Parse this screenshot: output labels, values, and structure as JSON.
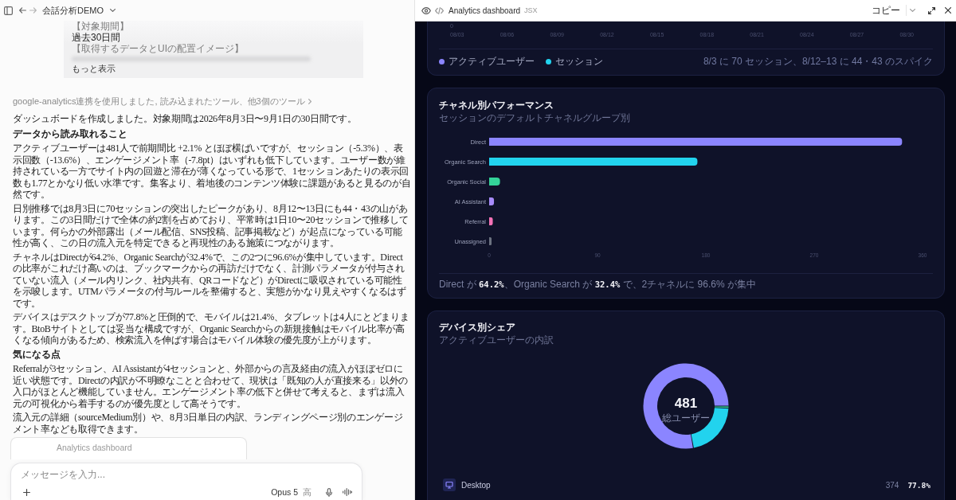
{
  "chat": {
    "title": "会話分析DEMO",
    "quoted_message": {
      "lines": [
        {
          "kind": "label",
          "text": "【対象期間】"
        },
        {
          "kind": "value",
          "text": "過去30日間"
        },
        {
          "kind": "label",
          "text": "【取得するデータとUIの配置イメージ】"
        },
        {
          "kind": "blurred"
        }
      ],
      "more_link": "もっと表示"
    },
    "tool_usage": "google-analytics連携を使用しました, 読み込まれたツール、他3個のツール",
    "response": [
      {
        "kind": "paragraph",
        "text": "ダッシュボードを作成しました。対象期間は2026年8月3日〜9月1日の30日間です。"
      },
      {
        "kind": "heading",
        "text": "データから読み取れること"
      },
      {
        "kind": "paragraph",
        "text": "アクティブユーザーは481人で前期間比 +2.1% とほぼ横ばいですが、セッション（-5.3%）、表示回数（-13.6%）、エンゲージメント率（-7.8pt）はいずれも低下しています。ユーザー数が維持されている一方でサイト内の回遊と滞在が薄くなっている形で、1セッションあたりの表示回数も1.77とかなり低い水準です。集客より、着地後のコンテンツ体験に課題があると見るのが自然です。"
      },
      {
        "kind": "paragraph",
        "text": "日別推移では8月3日に70セッションの突出したピークがあり、8月12〜13日にも44・43の山があります。この3日間だけで全体の約2割を占めており、平常時は1日10〜20セッションで推移しています。何らかの外部露出（メール配信、SNS投稿、記事掲載など）が起点になっている可能性が高く、この日の流入元を特定できると再現性のある施策につながります。"
      },
      {
        "kind": "paragraph",
        "text": "チャネルはDirectが64.2%、Organic Searchが32.4%で、この2つに96.6%が集中しています。Directの比率がこれだけ高いのは、ブックマークからの再訪だけでなく、計測パラメータが付与されていない流入（メール内リンク、社内共有、QRコードなど）がDirectに吸収されている可能性を示唆します。UTMパラメータの付与ルールを整備すると、実態がかなり見えやすくなるはずです。"
      },
      {
        "kind": "paragraph",
        "text": "デバイスはデスクトップが77.8%と圧倒的で、モバイルは21.4%、タブレットは4人にとどまります。BtoBサイトとしては妥当な構成ですが、Organic Searchからの新規接触はモバイル比率が高くなる傾向があるため、検索流入を伸ばす場合はモバイル体験の優先度が上がります。"
      },
      {
        "kind": "heading",
        "text": "気になる点"
      },
      {
        "kind": "paragraph",
        "text": "Referralが3セッション、AI Assistantが4セッションと、外部からの言及経由の流入がほぼゼロに近い状態です。Directの内訳が不明瞭なことと合わせて、現状は「既知の人が直接来る」以外の入口がほとんど機能していません。エンゲージメント率の低下と併せて考えると、まずは流入元の可視化から着手するのが優先度として高そうです。"
      },
      {
        "kind": "paragraph",
        "text": "流入元の詳細（sourceMedium別）や、8月3日単日の内訳、ランディングページ別のエンゲージメント率なども取得できます。"
      }
    ],
    "artifact_card": {
      "title": "Analytics dashboard"
    },
    "composer": {
      "placeholder": "メッセージを入力...",
      "model": "Opus 5",
      "effort": "高"
    }
  },
  "artifact": {
    "title": "Analytics dashboard",
    "file_type": "JSX",
    "copy_label": "コピー",
    "trend_card": {
      "y_ticks": [
        "0"
      ],
      "x_labels": [
        "08/03",
        "08/06",
        "08/09",
        "08/12",
        "08/15",
        "08/18",
        "08/21",
        "08/24",
        "08/27",
        "08/30"
      ],
      "legend": [
        {
          "label": "アクティブユーザー",
          "color": "#8b85ff"
        },
        {
          "label": "セッション",
          "color": "#22d3ee"
        }
      ],
      "note": "8/3 に 70 セッション、8/12–13 に 44・43 のスパイク"
    },
    "channel_card": {
      "title": "チャネル別パフォーマンス",
      "subtitle": "セッションのデフォルトチャネルグループ別",
      "chart_data": {
        "type": "bar",
        "orientation": "horizontal",
        "categories": [
          "Direct",
          "Organic Search",
          "Organic Social",
          "AI Assistant",
          "Referral",
          "Unassigned"
        ],
        "values": [
          343,
          173,
          9,
          4,
          3,
          2
        ],
        "xlim": [
          0,
          360
        ],
        "xticks": [
          0,
          90,
          180,
          270,
          360
        ]
      },
      "summary": "Direct が **64.2%**、Organic Search が **32.4%** で、2チャネルに 96.6% が集中"
    },
    "device_card": {
      "title": "デバイス別シェア",
      "subtitle": "アクティブユーザーの内訳",
      "chart_data": {
        "type": "donut",
        "values": [
          77.8,
          21.4,
          0.8
        ]
      },
      "center_value": "481",
      "center_label": "総ユーザー",
      "legend": [
        {
          "label": "Desktop",
          "count": "374",
          "share": "77.8%"
        }
      ]
    }
  }
}
